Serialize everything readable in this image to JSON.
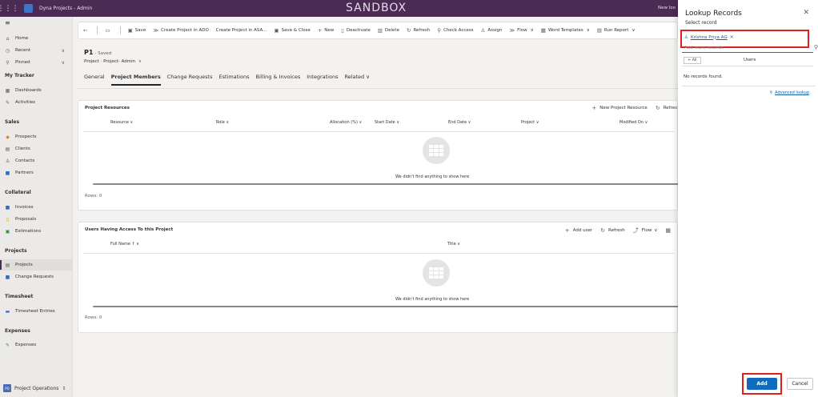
{
  "topbar": {
    "app_title": "Dyna Projects - Admin",
    "environment": "SANDBOX",
    "new_look": "New loo"
  },
  "sidebar": {
    "items": [
      {
        "label": "Home",
        "icon": "home-icon"
      },
      {
        "label": "Recent",
        "icon": "clock-icon"
      },
      {
        "label": "Pinned",
        "icon": "pin-icon"
      }
    ],
    "groups": [
      {
        "title": "My Tracker",
        "items": [
          "Dashboards",
          "Activities"
        ]
      },
      {
        "title": "Sales",
        "items": [
          "Prospects",
          "Clients",
          "Contacts",
          "Partners"
        ]
      },
      {
        "title": "Collateral",
        "items": [
          "Invoices",
          "Proposals",
          "Estimations"
        ]
      },
      {
        "title": "Projects",
        "items": [
          "Projects",
          "Change Requests"
        ]
      },
      {
        "title": "Timesheet",
        "items": [
          "Timesheet Entries"
        ]
      },
      {
        "title": "Expenses",
        "items": [
          "Expenses"
        ]
      }
    ],
    "area_badge": "PO",
    "area_label": "Project Operations"
  },
  "commandbar": [
    "Save",
    "Create Project in ADO",
    "Create Project in ASA...",
    "Save & Close",
    "New",
    "Deactivate",
    "Delete",
    "Refresh",
    "Check Access",
    "Assign",
    "Flow",
    "Word Templates",
    "Run Report"
  ],
  "record": {
    "title": "P1",
    "saved": "- Saved",
    "subtitle": "Project · Project- Admin"
  },
  "tabs": [
    "General",
    "Project Members",
    "Change Requests",
    "Estimations",
    "Billing & Invoices",
    "Integrations",
    "Related"
  ],
  "resources": {
    "title": "Project Resources",
    "actions": [
      "New Project Resource",
      "Refres"
    ],
    "columns": [
      "Resource",
      "Role",
      "Allocation (%)",
      "Start Date",
      "End Date",
      "Project",
      "Modified On"
    ],
    "empty": "We didn't find anything to show here",
    "rows": "Rows: 0"
  },
  "access": {
    "title": "Users Having Access To this Project",
    "actions": [
      "Add user",
      "Refresh",
      "Flow"
    ],
    "columns": [
      "Full Name ↑",
      "Title"
    ],
    "empty": "We didn't find anything to show here",
    "rows": "Rows: 0"
  },
  "lookup": {
    "title": "Lookup Records",
    "subtitle": "Select record",
    "selected": "Krishna Priya AG",
    "search_placeholder": "Add more records",
    "all_label": "← All",
    "users_label": "Users",
    "no_records": "No records found.",
    "advanced": "Advanced lookup",
    "add": "Add",
    "cancel": "Cancel"
  },
  "colors": {
    "topbar": "#4b2a53",
    "primary": "#0f6cbd",
    "highlight": "#e0201b"
  }
}
